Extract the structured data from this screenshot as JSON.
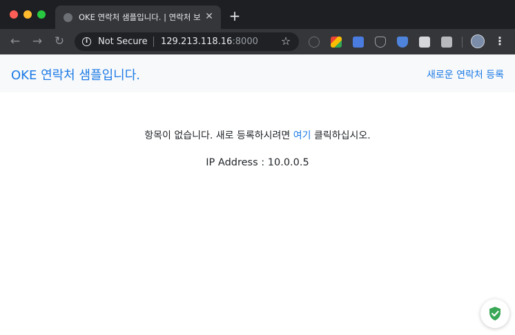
{
  "browser": {
    "tab": {
      "title": "OKE 연락처 샘플입니다. | 연락처 보",
      "close_glyph": "✕"
    },
    "new_tab_glyph": "+",
    "nav": {
      "back_glyph": "←",
      "forward_glyph": "→",
      "reload_glyph": "↻"
    },
    "omnibox": {
      "security_label": "Not Secure",
      "host": "129.213.118.16",
      "port": ":8000",
      "info_glyph": "i",
      "star_glyph": "☆"
    },
    "menu_glyph": "⋮",
    "extensions": [
      "privacy-icon",
      "drive-icon",
      "translate-icon",
      "pocket-icon",
      "shield-extension-icon",
      "notes-icon",
      "bookmark-extension-icon"
    ],
    "colors": {
      "titlebar": "#1e1f22",
      "toolbar": "#35363a",
      "omnibox": "#202124",
      "traffic_red": "#ff5f57",
      "traffic_yellow": "#febc2e",
      "traffic_green": "#28c840"
    }
  },
  "page": {
    "brand": "OKE 연락처 샘플입니다.",
    "register_link": "새로운 연락처 등록",
    "empty_message_before": "항목이 없습니다. 새로 등록하시려면 ",
    "empty_message_link": "여기",
    "empty_message_after": " 클릭하십시오.",
    "ip_line": "IP Address : 10.0.0.5",
    "colors": {
      "link": "#1a7ae6",
      "header_bg": "#f8f9fa",
      "text": "#212529",
      "badge_shield": "#3aa757"
    }
  }
}
